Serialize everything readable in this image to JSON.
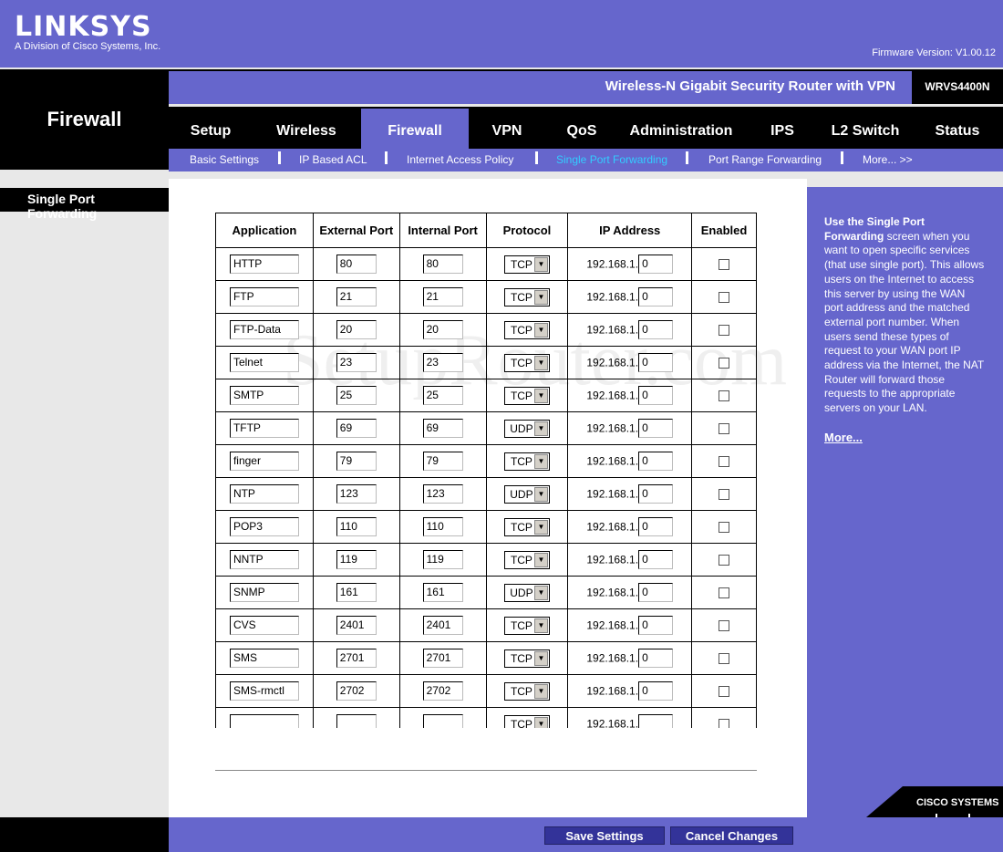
{
  "header": {
    "brand": "LINKSYS",
    "brand_sub": "A Division of Cisco Systems, Inc.",
    "firmware": "Firmware Version: V1.00.12",
    "section_title": "Firewall",
    "product_name": "Wireless-N Gigabit Security Router with VPN",
    "model": "WRVS4400N"
  },
  "tabs": [
    {
      "label": "Setup"
    },
    {
      "label": "Wireless"
    },
    {
      "label": "Firewall",
      "active": true
    },
    {
      "label": "VPN"
    },
    {
      "label": "QoS"
    },
    {
      "label": "Administration"
    },
    {
      "label": "IPS"
    },
    {
      "label": "L2 Switch"
    },
    {
      "label": "Status"
    }
  ],
  "subnav": [
    {
      "label": "Basic Settings"
    },
    {
      "label": "IP Based ACL"
    },
    {
      "label": "Internet Access Policy"
    },
    {
      "label": "Single Port Forwarding",
      "active": true
    },
    {
      "label": "Port Range Forwarding"
    },
    {
      "label": "More... >>"
    }
  ],
  "sidebar": {
    "subtitle": "Single Port Forwarding"
  },
  "table": {
    "headers": [
      "Application",
      "External Port",
      "Internal Port",
      "Protocol",
      "IP Address",
      "Enabled"
    ],
    "ip_prefix": "192.168.1.",
    "rows": [
      {
        "app": "HTTP",
        "ext": "80",
        "int": "80",
        "proto": "TCP",
        "ip": "0",
        "enabled": false
      },
      {
        "app": "FTP",
        "ext": "21",
        "int": "21",
        "proto": "TCP",
        "ip": "0",
        "enabled": false
      },
      {
        "app": "FTP-Data",
        "ext": "20",
        "int": "20",
        "proto": "TCP",
        "ip": "0",
        "enabled": false
      },
      {
        "app": "Telnet",
        "ext": "23",
        "int": "23",
        "proto": "TCP",
        "ip": "0",
        "enabled": false
      },
      {
        "app": "SMTP",
        "ext": "25",
        "int": "25",
        "proto": "TCP",
        "ip": "0",
        "enabled": false
      },
      {
        "app": "TFTP",
        "ext": "69",
        "int": "69",
        "proto": "UDP",
        "ip": "0",
        "enabled": false
      },
      {
        "app": "finger",
        "ext": "79",
        "int": "79",
        "proto": "TCP",
        "ip": "0",
        "enabled": false
      },
      {
        "app": "NTP",
        "ext": "123",
        "int": "123",
        "proto": "UDP",
        "ip": "0",
        "enabled": false
      },
      {
        "app": "POP3",
        "ext": "110",
        "int": "110",
        "proto": "TCP",
        "ip": "0",
        "enabled": false
      },
      {
        "app": "NNTP",
        "ext": "119",
        "int": "119",
        "proto": "TCP",
        "ip": "0",
        "enabled": false
      },
      {
        "app": "SNMP",
        "ext": "161",
        "int": "161",
        "proto": "UDP",
        "ip": "0",
        "enabled": false
      },
      {
        "app": "CVS",
        "ext": "2401",
        "int": "2401",
        "proto": "TCP",
        "ip": "0",
        "enabled": false
      },
      {
        "app": "SMS",
        "ext": "2701",
        "int": "2701",
        "proto": "TCP",
        "ip": "0",
        "enabled": false
      },
      {
        "app": "SMS-rmctl",
        "ext": "2702",
        "int": "2702",
        "proto": "TCP",
        "ip": "0",
        "enabled": false
      },
      {
        "app": "",
        "ext": "",
        "int": "",
        "proto": "TCP",
        "ip": "",
        "enabled": false
      }
    ]
  },
  "help": {
    "bold": "Use the Single Port Forwarding",
    "text": " screen when you want to open specific services (that use single port). This allows users on the Internet to access this server by using the WAN port address and the matched external port number. When users send these types of request to your WAN port IP address via the Internet, the NAT Router will forward those requests to the appropriate servers on your LAN.",
    "more": "More..."
  },
  "cisco_logo": "Cisco Systems",
  "actions": {
    "save": "Save Settings",
    "cancel": "Cancel Changes"
  },
  "watermark": "SetupRouter.com",
  "colors": {
    "brand": "#6666cc",
    "active_sub": "#33ccff",
    "button": "#333399"
  }
}
